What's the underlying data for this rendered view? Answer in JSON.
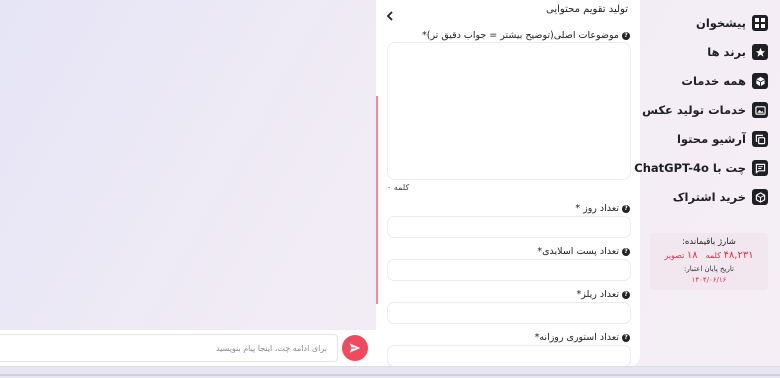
{
  "chat": {
    "input_placeholder": "برای ادامه چت، اینجا پیام بنویسید"
  },
  "form": {
    "title": "تولید تقویم محتوایی",
    "fields": [
      {
        "label": "موضوعات اصلی(توضیح بیشتر = جواب دقیق تر)*"
      },
      {
        "label": "تعداد روز *"
      },
      {
        "label": "تعداد پست اسلایدی*"
      },
      {
        "label": "تعداد ریلز*"
      },
      {
        "label": "تعداد استوری روزانه*"
      }
    ],
    "word_count": "۰ کلمه",
    "help_symbol": "?"
  },
  "sidebar": {
    "items": [
      {
        "label": "پیشخوان",
        "icon": "dashboard-icon"
      },
      {
        "label": "برند ها",
        "icon": "star-icon"
      },
      {
        "label": "همه خدمات",
        "icon": "box-icon"
      },
      {
        "label": "خدمات تولید عکس",
        "icon": "image-icon"
      },
      {
        "label": "آرشیو محتوا",
        "icon": "copy-icon"
      },
      {
        "label": "چت با ChatGPT-4o",
        "icon": "chat-icon"
      },
      {
        "label": "خرید اشتراک",
        "icon": "package-icon"
      }
    ],
    "credit": {
      "title": "شارژ باقیمانده:",
      "words_value": "۴۸,۲۳۱",
      "words_unit": "کلمه",
      "images_value": "۱۸",
      "images_unit": "تصویر",
      "expiry_label": "تاریخ پایان اعتبار:",
      "expiry_date": "۱۴۰۴/۰۶/۱۶"
    }
  },
  "colors": {
    "accent": "#f04a5e",
    "credit_red": "#e0304a",
    "icon_dark": "#1f1f24"
  }
}
